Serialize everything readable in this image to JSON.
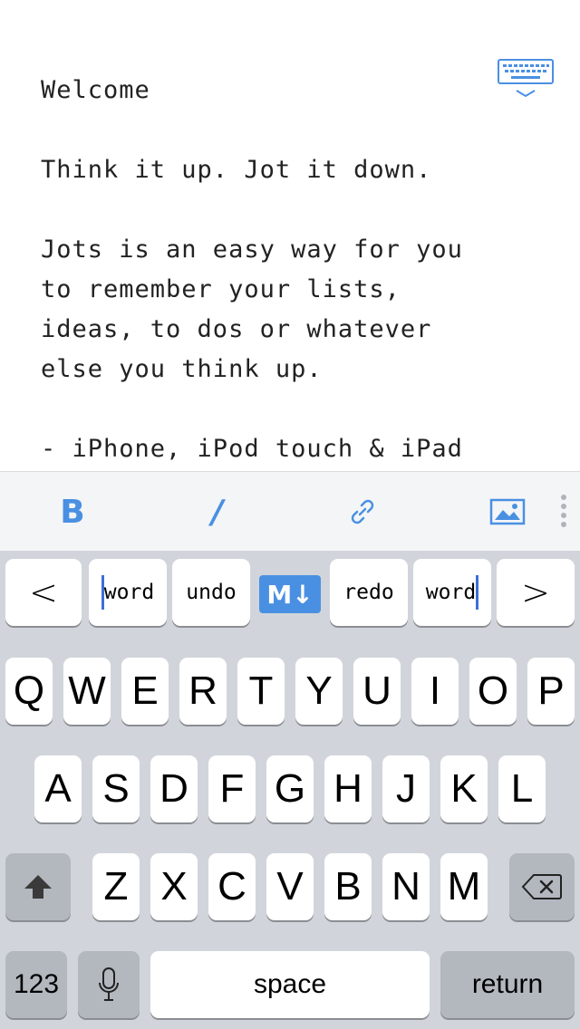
{
  "note": {
    "text": "Welcome\n\nThink it up. Jot it down.\n\nJots is an easy way for you\nto remember your lists,\nideas, to dos or whatever\nelse you think up.\n\n- iPhone, iPod touch & iPad"
  },
  "toolbar": {
    "dismiss_keyboard_icon": "keyboard-dismiss-icon",
    "bold_label": "B",
    "italic_label": "/",
    "link_icon": "link-icon",
    "image_icon": "image-icon",
    "more_icon": "more-vertical-icon"
  },
  "shortcut_row": {
    "prev": "<",
    "word_left": "word",
    "undo": "undo",
    "markdown_badge": "M↓",
    "redo": "redo",
    "word_right": "word",
    "next": ">"
  },
  "keyboard": {
    "row1": [
      "Q",
      "W",
      "E",
      "R",
      "T",
      "Y",
      "U",
      "I",
      "O",
      "P"
    ],
    "row2": [
      "A",
      "S",
      "D",
      "F",
      "G",
      "H",
      "J",
      "K",
      "L"
    ],
    "row3": [
      "Z",
      "X",
      "C",
      "V",
      "B",
      "N",
      "M"
    ],
    "shift_icon": "shift-icon",
    "delete_icon": "delete-icon",
    "numbers": "123",
    "mic_icon": "microphone-icon",
    "space": "space",
    "return": "return"
  },
  "colors": {
    "accent": "#4a90e2",
    "keyboard_bg": "#d1d5db",
    "dark_key": "#b3b8bf"
  }
}
